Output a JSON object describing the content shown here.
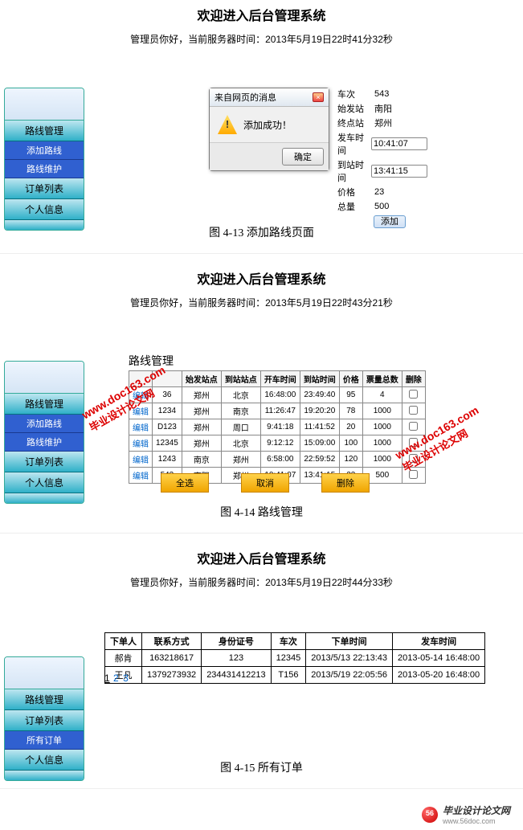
{
  "common": {
    "header": "欢迎进入后台管理系统",
    "admin_prefix": "管理员你好，当前服务器时间："
  },
  "section1": {
    "time": "2013年5月19日22时41分32秒",
    "sidebar": [
      "路线管理",
      "添加路线",
      "路线维护",
      "订单列表",
      "个人信息"
    ],
    "dialog": {
      "title": "来自网页的消息",
      "msg": "添加成功！",
      "ok": "确定"
    },
    "form": {
      "bus_lbl": "车次",
      "bus": "543",
      "start_lbl": "始发站",
      "start": "南阳",
      "end_lbl": "终点站",
      "end": "郑州",
      "dep_lbl": "发车时间",
      "dep": "10:41:07",
      "arr_lbl": "到站时间",
      "arr": "13:41:15",
      "price_lbl": "价格",
      "price": "23",
      "total_lbl": "总量",
      "total": "500",
      "add": "添加"
    },
    "caption": "图 4-13 添加路线页面"
  },
  "section2": {
    "time": "2013年5月19日22时43分21秒",
    "title": "路线管理",
    "sidebar": [
      "路线管理",
      "添加路线",
      "路线维护",
      "订单列表",
      "个人信息"
    ],
    "headers": [
      "",
      "",
      "始发站点",
      "到站站点",
      "开车时间",
      "到站时间",
      "价格",
      "票量总数",
      "删除"
    ],
    "rows": [
      {
        "op": "编辑",
        "bus": "36",
        "from": "郑州",
        "to": "北京",
        "dep": "16:48:00",
        "arr": "23:49:40",
        "price": "95",
        "qty": "4"
      },
      {
        "op": "编辑",
        "bus": "1234",
        "from": "郑州",
        "to": "南京",
        "dep": "11:26:47",
        "arr": "19:20:20",
        "price": "78",
        "qty": "1000"
      },
      {
        "op": "编辑",
        "bus": "D123",
        "from": "郑州",
        "to": "周口",
        "dep": "9:41:18",
        "arr": "11:41:52",
        "price": "20",
        "qty": "1000"
      },
      {
        "op": "编辑",
        "bus": "12345",
        "from": "郑州",
        "to": "北京",
        "dep": "9:12:12",
        "arr": "15:09:00",
        "price": "100",
        "qty": "1000"
      },
      {
        "op": "编辑",
        "bus": "1243",
        "from": "南京",
        "to": "郑州",
        "dep": "6:58:00",
        "arr": "22:59:52",
        "price": "120",
        "qty": "1000"
      },
      {
        "op": "编辑",
        "bus": "543",
        "from": "南阳",
        "to": "郑州",
        "dep": "10:41:07",
        "arr": "13:41:15",
        "price": "23",
        "qty": "500"
      }
    ],
    "btns": {
      "all": "全选",
      "cancel": "取消",
      "delete": "删除"
    },
    "watermarks": {
      "url": "www.doc163.com",
      "cn": "毕业设计论文网"
    },
    "caption": "图 4-14 路线管理"
  },
  "section3": {
    "time": "2013年5月19日22时44分33秒",
    "sidebar": [
      "路线管理",
      "订单列表",
      "所有订单",
      "个人信息"
    ],
    "headers": [
      "下单人",
      "联系方式",
      "身份证号",
      "车次",
      "下单时间",
      "发车时间"
    ],
    "rows": [
      {
        "name": "郝肯",
        "phone": "163218617",
        "id": "123",
        "bus": "12345",
        "otime": "2013/5/13 22:13:43",
        "dtime": "2013-05-14 16:48:00"
      },
      {
        "name": "王凡",
        "phone": "1379273932",
        "id": "234431412213",
        "bus": "T156",
        "otime": "2013/5/19 22:05:56",
        "dtime": "2013-05-20 16:48:00"
      }
    ],
    "pager": [
      "1",
      "2",
      "3"
    ],
    "caption": "图 4-15 所有订单"
  },
  "footer": {
    "text": "毕业设计论文网",
    "url": "www.56doc.com"
  }
}
